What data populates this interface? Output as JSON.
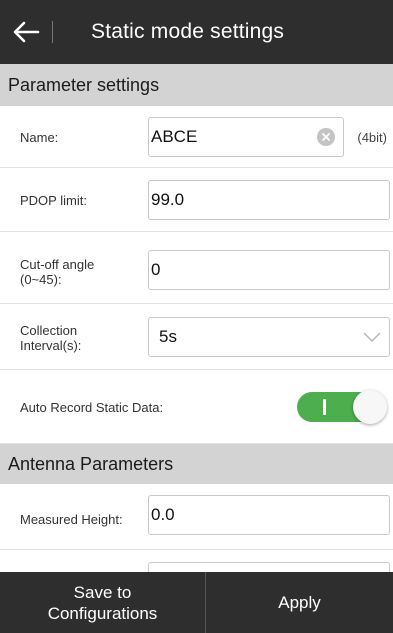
{
  "header": {
    "title": "Static mode settings",
    "back_icon": "arrow-left-icon"
  },
  "sections": {
    "parameter_settings": "Parameter settings",
    "antenna_parameters": "Antenna Parameters"
  },
  "fields": {
    "name": {
      "label": "Name:",
      "value": "ABCE",
      "hint": "(4bit)"
    },
    "pdop_limit": {
      "label": "PDOP limit:",
      "value": "99.0"
    },
    "cutoff_angle": {
      "label_line1": "Cut-off angle",
      "label_line2": "(0~45):",
      "value": "0"
    },
    "collection_interval": {
      "label_line1": "Collection",
      "label_line2": "Interval(s):",
      "value": "5s"
    },
    "auto_record": {
      "label": "Auto Record Static Data:",
      "enabled": true,
      "on_color": "#4cae4c"
    },
    "measured_height": {
      "label": "Measured Height:",
      "value": "0.0"
    }
  },
  "footer": {
    "save_line1": "Save to",
    "save_line2": "Configurations",
    "apply": "Apply"
  },
  "colors": {
    "header_bg": "#2e2e2e",
    "section_bg": "#d3d3d3",
    "toggle_on": "#4cae4c"
  }
}
